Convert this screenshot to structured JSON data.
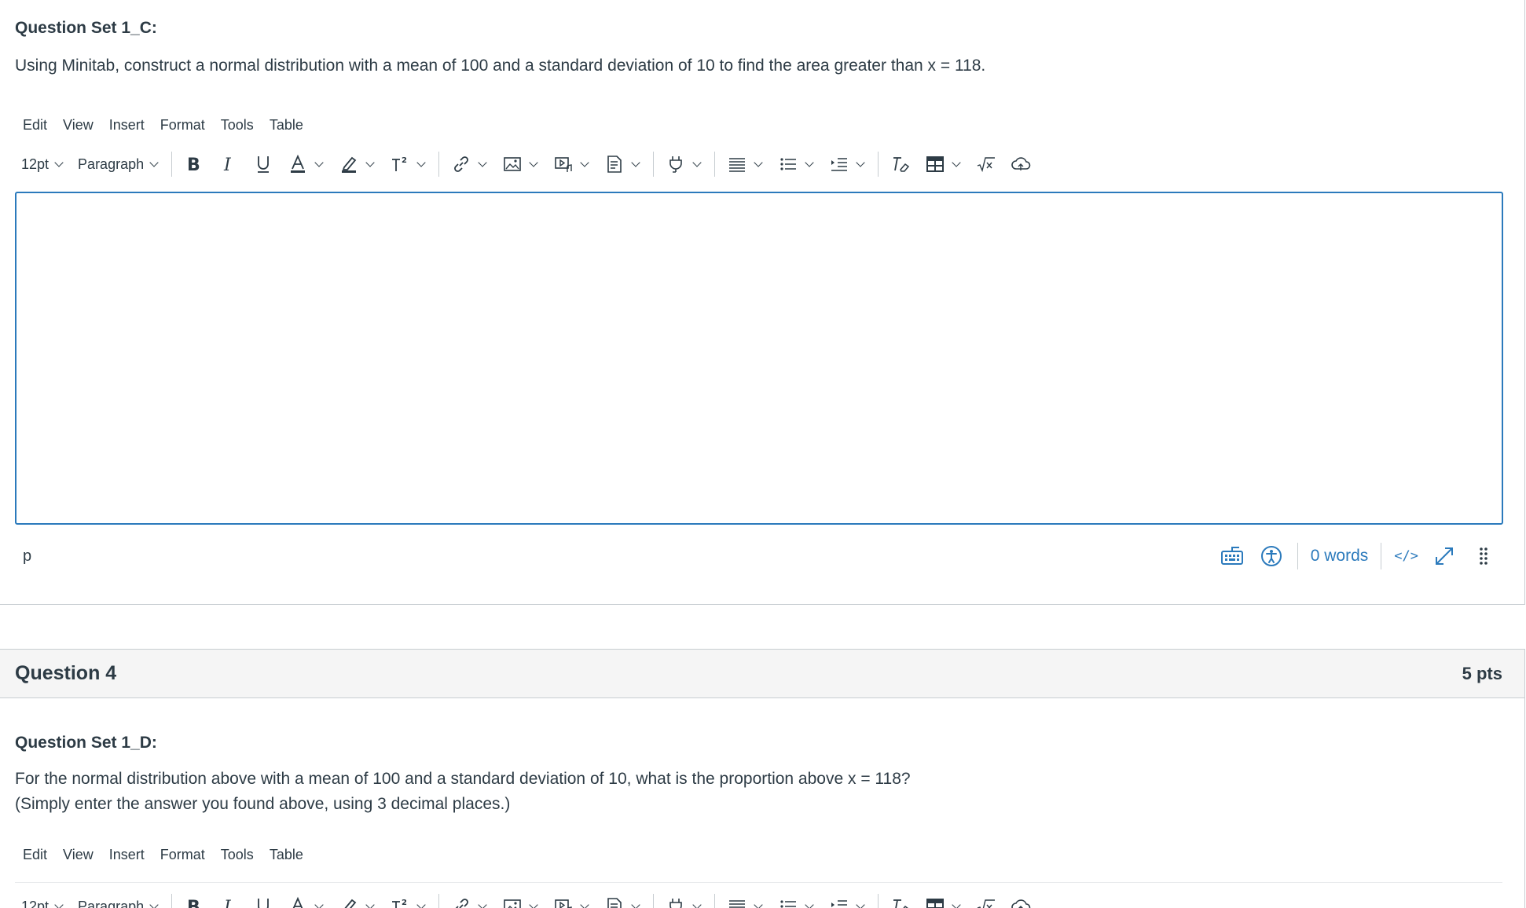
{
  "question3": {
    "set_label": "Question Set 1_C:",
    "prompt": "Using Minitab, construct a normal distribution with a mean of 100 and a standard deviation of 10 to find the area greater than x = 118."
  },
  "question4": {
    "title": "Question 4",
    "points": "5 pts",
    "set_label": "Question Set 1_D:",
    "prompt_line1": "For the normal distribution above with a mean of 100 and a standard deviation of 10, what is the proportion above x = 118?",
    "prompt_line2": "(Simply enter the answer you found above, using 3 decimal places.)"
  },
  "editor": {
    "menu": [
      "Edit",
      "View",
      "Insert",
      "Format",
      "Tools",
      "Table"
    ],
    "font_size": "12pt",
    "block_format": "Paragraph",
    "status_path": "p",
    "word_count": "0 words",
    "html_toggle": "</>"
  },
  "colors": {
    "accent": "#2b7abc",
    "text": "#2d3b45",
    "header_bg": "#f5f5f5",
    "border": "#c7cdd1"
  }
}
